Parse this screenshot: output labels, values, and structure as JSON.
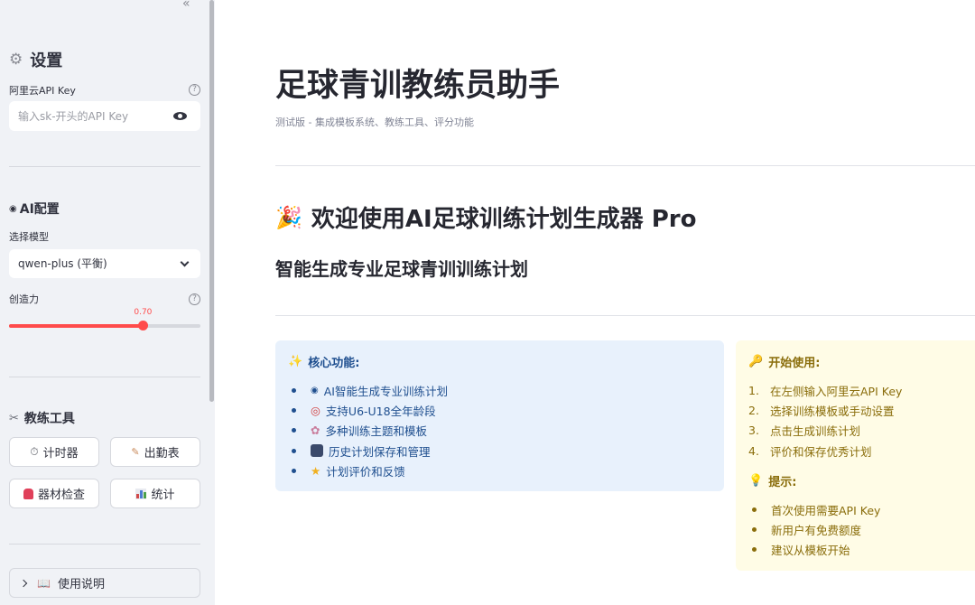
{
  "sidebar": {
    "settings_title": "设置",
    "api_key_label": "阿里云API Key",
    "api_key_placeholder": "输入sk-开头的API Key",
    "ai_config_title": "AI配置",
    "model_label": "选择模型",
    "model_value": "qwen-plus (平衡)",
    "creativity_label": "创造力",
    "creativity_value": "0.70",
    "creativity_fraction": 0.7,
    "coach_tools_title": "教练工具",
    "tools": [
      {
        "label": "计时器",
        "icon": "stopwatch-icon"
      },
      {
        "label": "出勤表",
        "icon": "memo-icon"
      },
      {
        "label": "器材检查",
        "icon": "backpack-icon"
      },
      {
        "label": "统计",
        "icon": "bar-chart-icon"
      }
    ],
    "help_expander": "使用说明"
  },
  "main": {
    "title": "足球青训教练员助手",
    "caption": "测试版 - 集成模板系统、教练工具、评分功能",
    "welcome_heading": "欢迎使用AI足球训练计划生成器 Pro",
    "subheading": "智能生成专业足球青训训练计划",
    "features": {
      "heading": "核心功能:",
      "items": [
        "AI智能生成专业训练计划",
        "支持U6-U18全年龄段",
        "多种训练主题和模板",
        "历史计划保存和管理",
        "计划评价和反馈"
      ]
    },
    "getting_started": {
      "heading": "开始使用:",
      "steps": [
        "在左侧输入阿里云API Key",
        "选择训练模板或手动设置",
        "点击生成训练计划",
        "评价和保存优秀计划"
      ],
      "tips_heading": "提示:",
      "tips": [
        "首次使用需要API Key",
        "新用户有免费额度",
        "建议从模板开始"
      ]
    }
  },
  "colors": {
    "accent": "#ff4b4b",
    "info_bg": "#e8f1fc",
    "info_text": "#1f4f8f",
    "warning_bg": "#fffce6",
    "warning_text": "#8a6d0b"
  }
}
